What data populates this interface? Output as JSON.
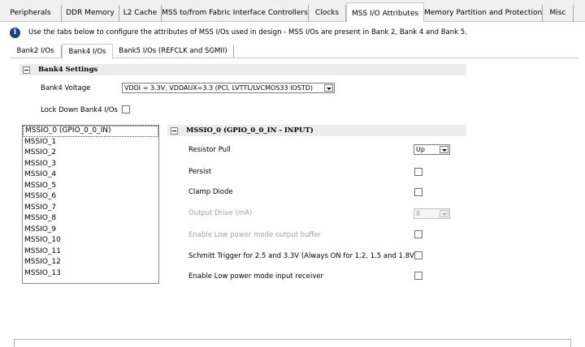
{
  "top_tabs": [
    {
      "label": "Peripherals",
      "active": false
    },
    {
      "label": "DDR Memory",
      "active": false
    },
    {
      "label": "L2 Cache",
      "active": false
    },
    {
      "label": "MSS to/from Fabric Interface Controllers",
      "active": false
    },
    {
      "label": "Clocks",
      "active": false
    },
    {
      "label": "MSS I/O Attributes",
      "active": true
    },
    {
      "label": "Memory Partition and Protection",
      "active": false
    },
    {
      "label": "Misc",
      "active": false
    }
  ],
  "info": {
    "icon": "info-icon",
    "text": "Use the tabs below to configure the attributes of MSS I/Os used in design - MSS I/Os are present in Bank 2, Bank 4 and Bank 5."
  },
  "sub_tabs": [
    {
      "label": "Bank2 I/Os",
      "active": false
    },
    {
      "label": "Bank4 I/Os",
      "active": true
    },
    {
      "label": "Bank5 I/Os (REFCLK and SGMII)",
      "active": false
    }
  ],
  "bank_settings": {
    "title": "Bank4 Settings",
    "voltage_label": "Bank4 Voltage",
    "voltage_value": "VDDI = 3.3V, VDDAUX=3.3 (PCI, LVTTL/LVCMOS33 IOSTD)",
    "lockdown_label": "Lock Down Bank4 I/Os",
    "lockdown_checked": false
  },
  "io_list": {
    "items": [
      "MSSIO_0 (GPIO_0_0_IN)",
      "MSSIO_1",
      "MSSIO_2",
      "MSSIO_3",
      "MSSIO_4",
      "MSSIO_5",
      "MSSIO_6",
      "MSSIO_7",
      "MSSIO_8",
      "MSSIO_9",
      "MSSIO_10",
      "MSSIO_11",
      "MSSIO_12",
      "MSSIO_13"
    ],
    "selected_index": 0
  },
  "io_settings": {
    "title": "MSSIO_0 (GPIO_0_0_IN - INPUT)",
    "resistor_pull_label": "Resistor Pull",
    "resistor_pull_value": "Up",
    "persist_label": "Persist",
    "persist_checked": false,
    "clamp_diode_label": "Clamp Diode",
    "clamp_diode_checked": false,
    "output_drive_label": "Output Drive (mA)",
    "output_drive_value": "8",
    "low_power_output_label": "Enable Low power mode output buffer",
    "low_power_output_checked": false,
    "schmitt_label": "Schmitt Trigger for 2.5 and 3.3V (Always ON for 1.2, 1.5 and 1.8V)",
    "schmitt_checked": false,
    "low_power_input_label": "Enable Low power mode input receiver",
    "low_power_input_checked": false
  },
  "colors": {
    "info_icon": "#1e3f7a",
    "section_header_bg": "#ececec",
    "disabled_text": "#a0a0a0"
  }
}
